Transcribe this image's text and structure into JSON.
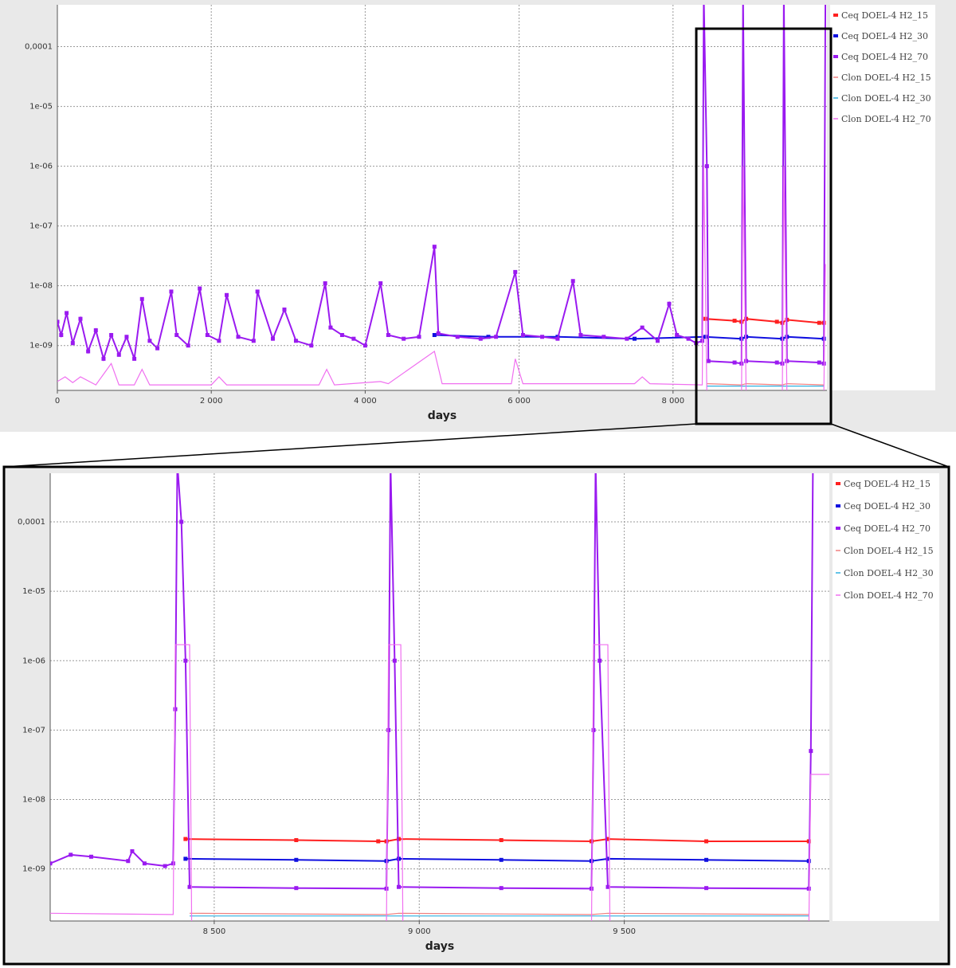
{
  "chart_data": [
    {
      "name": "overview",
      "type": "line",
      "xlabel": "days",
      "ylabel": "",
      "title": "",
      "yscale": "log",
      "xlim": [
        0,
        10000
      ],
      "ylim_log10": [
        -9.75,
        -3.3
      ],
      "x_ticks": [
        0,
        2000,
        4000,
        6000,
        8000
      ],
      "x_tick_labels": [
        "0",
        "2 000",
        "4 000",
        "6 000",
        "8 000"
      ],
      "y_ticks_log10": [
        -9,
        -8,
        -7,
        -6,
        -5,
        -4
      ],
      "y_tick_labels": [
        "1e-09",
        "1e-08",
        "1e-07",
        "1e-06",
        "1e-05",
        "0,0001"
      ],
      "grid": true,
      "legend_position": "right",
      "series": [
        {
          "name": "Ceq DOEL-4 H2_15",
          "color": "#ff2020",
          "style": "markers",
          "points": [
            [
              8420,
              2.8e-09
            ],
            [
              8800,
              2.6e-09
            ],
            [
              8890,
              2.5e-09
            ],
            [
              8950,
              2.8e-09
            ],
            [
              9350,
              2.5e-09
            ],
            [
              9420,
              2.4e-09
            ],
            [
              9480,
              2.7e-09
            ],
            [
              9900,
              2.4e-09
            ],
            [
              9960,
              2.4e-09
            ]
          ]
        },
        {
          "name": "Ceq DOEL-4 H2_30",
          "color": "#1010e0",
          "style": "markers",
          "points": [
            [
              4900,
              1.5e-09
            ],
            [
              5600,
              1.4e-09
            ],
            [
              6500,
              1.4e-09
            ],
            [
              7500,
              1.3e-09
            ],
            [
              8420,
              1.4e-09
            ],
            [
              8890,
              1.3e-09
            ],
            [
              8950,
              1.4e-09
            ],
            [
              9420,
              1.3e-09
            ],
            [
              9480,
              1.4e-09
            ],
            [
              9960,
              1.3e-09
            ]
          ]
        },
        {
          "name": "Ceq DOEL-4 H2_70",
          "color": "#9a1af0",
          "style": "markers",
          "points": [
            [
              0,
              2.5e-09
            ],
            [
              50,
              1.5e-09
            ],
            [
              120,
              3.5e-09
            ],
            [
              200,
              1.1e-09
            ],
            [
              300,
              2.8e-09
            ],
            [
              400,
              8e-10
            ],
            [
              500,
              1.8e-09
            ],
            [
              600,
              6e-10
            ],
            [
              700,
              1.5e-09
            ],
            [
              800,
              7e-10
            ],
            [
              900,
              1.4e-09
            ],
            [
              1000,
              6e-10
            ],
            [
              1100,
              6e-09
            ],
            [
              1200,
              1.2e-09
            ],
            [
              1300,
              9e-10
            ],
            [
              1480,
              8e-09
            ],
            [
              1550,
              1.5e-09
            ],
            [
              1700,
              1e-09
            ],
            [
              1850,
              9e-09
            ],
            [
              1950,
              1.5e-09
            ],
            [
              2100,
              1.2e-09
            ],
            [
              2200,
              7e-09
            ],
            [
              2350,
              1.4e-09
            ],
            [
              2550,
              1.2e-09
            ],
            [
              2600,
              8e-09
            ],
            [
              2800,
              1.3e-09
            ],
            [
              2950,
              4e-09
            ],
            [
              3100,
              1.2e-09
            ],
            [
              3300,
              1e-09
            ],
            [
              3480,
              1.1e-08
            ],
            [
              3550,
              2e-09
            ],
            [
              3700,
              1.5e-09
            ],
            [
              3850,
              1.3e-09
            ],
            [
              4000,
              1e-09
            ],
            [
              4200,
              1.1e-08
            ],
            [
              4300,
              1.5e-09
            ],
            [
              4500,
              1.3e-09
            ],
            [
              4700,
              1.4e-09
            ],
            [
              4900,
              4.5e-08
            ],
            [
              4950,
              1.6e-09
            ],
            [
              5200,
              1.4e-09
            ],
            [
              5500,
              1.3e-09
            ],
            [
              5700,
              1.4e-09
            ],
            [
              5950,
              1.7e-08
            ],
            [
              6050,
              1.5e-09
            ],
            [
              6300,
              1.4e-09
            ],
            [
              6500,
              1.3e-09
            ],
            [
              6700,
              1.2e-08
            ],
            [
              6800,
              1.5e-09
            ],
            [
              7100,
              1.4e-09
            ],
            [
              7400,
              1.3e-09
            ],
            [
              7600,
              2e-09
            ],
            [
              7800,
              1.2e-09
            ],
            [
              7950,
              5e-09
            ],
            [
              8050,
              1.5e-09
            ],
            [
              8200,
              1.3e-09
            ],
            [
              8300,
              1.1e-09
            ],
            [
              8380,
              1.2e-09
            ],
            [
              8400,
              0.0007
            ],
            [
              8440,
              1e-06
            ],
            [
              8460,
              5.5e-10
            ],
            [
              8800,
              5.2e-10
            ],
            [
              8890,
              5e-10
            ],
            [
              8910,
              0.0007
            ],
            [
              8950,
              5.5e-10
            ],
            [
              9350,
              5.2e-10
            ],
            [
              9420,
              5e-10
            ],
            [
              9440,
              0.0007
            ],
            [
              9480,
              5.5e-10
            ],
            [
              9900,
              5.2e-10
            ],
            [
              9960,
              5e-10
            ],
            [
              9980,
              0.0007
            ]
          ]
        },
        {
          "name": "Clon DOEL-4 H2_15",
          "color": "#f08080",
          "style": "line",
          "points": [
            [
              8440,
              2.3e-10
            ],
            [
              8890,
              2.2e-10
            ],
            [
              8950,
              2.3e-10
            ],
            [
              9420,
              2.2e-10
            ],
            [
              9480,
              2.3e-10
            ],
            [
              9960,
              2.2e-10
            ]
          ]
        },
        {
          "name": "Clon DOEL-4 H2_30",
          "color": "#30b0e0",
          "style": "line",
          "points": [
            [
              8440,
              2.1e-10
            ],
            [
              8890,
              2.1e-10
            ],
            [
              8950,
              2.1e-10
            ],
            [
              9420,
              2.1e-10
            ],
            [
              9480,
              2.1e-10
            ],
            [
              9960,
              2.1e-10
            ]
          ]
        },
        {
          "name": "Clon DOEL-4 H2_70",
          "color": "#f070f0",
          "style": "line",
          "points": [
            [
              0,
              2.5e-10
            ],
            [
              100,
              3e-10
            ],
            [
              200,
              2.4e-10
            ],
            [
              300,
              3e-10
            ],
            [
              500,
              2.2e-10
            ],
            [
              700,
              5e-10
            ],
            [
              800,
              2.2e-10
            ],
            [
              1000,
              2.2e-10
            ],
            [
              1100,
              4e-10
            ],
            [
              1200,
              2.2e-10
            ],
            [
              2000,
              2.2e-10
            ],
            [
              2100,
              3e-10
            ],
            [
              2200,
              2.2e-10
            ],
            [
              3000,
              2.2e-10
            ],
            [
              3400,
              2.2e-10
            ],
            [
              3500,
              4e-10
            ],
            [
              3600,
              2.2e-10
            ],
            [
              4200,
              2.5e-10
            ],
            [
              4300,
              2.3e-10
            ],
            [
              4900,
              8e-10
            ],
            [
              5000,
              2.3e-10
            ],
            [
              5900,
              2.3e-10
            ],
            [
              5950,
              6e-10
            ],
            [
              6050,
              2.3e-10
            ],
            [
              7000,
              2.3e-10
            ],
            [
              7500,
              2.3e-10
            ],
            [
              7600,
              3e-10
            ],
            [
              7700,
              2.3e-10
            ],
            [
              8380,
              2.2e-10
            ],
            [
              8400,
              1e-06
            ],
            [
              8440,
              1.5e-10
            ],
            [
              8890,
              1.5e-10
            ],
            [
              8910,
              1e-06
            ],
            [
              8950,
              1.5e-10
            ],
            [
              9420,
              1.5e-10
            ],
            [
              9440,
              1e-06
            ],
            [
              9480,
              1.5e-10
            ],
            [
              9960,
              1.5e-10
            ],
            [
              9980,
              2.3e-08
            ]
          ]
        }
      ]
    },
    {
      "name": "zoom",
      "type": "line",
      "xlabel": "days",
      "ylabel": "",
      "title": "",
      "yscale": "log",
      "xlim": [
        8100,
        10000
      ],
      "ylim_log10": [
        -9.75,
        -3.3
      ],
      "x_ticks": [
        8500,
        9000,
        9500
      ],
      "x_tick_labels": [
        "8 500",
        "9 000",
        "9 500"
      ],
      "y_ticks_log10": [
        -9,
        -8,
        -7,
        -6,
        -5,
        -4
      ],
      "y_tick_labels": [
        "1e-09",
        "1e-08",
        "1e-07",
        "1e-06",
        "1e-05",
        "0,0001"
      ],
      "grid": true,
      "legend_position": "right",
      "series": [
        {
          "name": "Ceq DOEL-4 H2_15",
          "color": "#ff2020",
          "style": "markers",
          "points": [
            [
              8430,
              2.7e-09
            ],
            [
              8700,
              2.6e-09
            ],
            [
              8900,
              2.5e-09
            ],
            [
              8920,
              2.5e-09
            ],
            [
              8950,
              2.7e-09
            ],
            [
              9200,
              2.6e-09
            ],
            [
              9420,
              2.5e-09
            ],
            [
              9460,
              2.7e-09
            ],
            [
              9700,
              2.5e-09
            ],
            [
              9950,
              2.5e-09
            ]
          ]
        },
        {
          "name": "Ceq DOEL-4 H2_30",
          "color": "#1010e0",
          "style": "markers",
          "points": [
            [
              8430,
              1.4e-09
            ],
            [
              8700,
              1.35e-09
            ],
            [
              8920,
              1.3e-09
            ],
            [
              8950,
              1.4e-09
            ],
            [
              9200,
              1.35e-09
            ],
            [
              9420,
              1.3e-09
            ],
            [
              9460,
              1.4e-09
            ],
            [
              9700,
              1.35e-09
            ],
            [
              9950,
              1.3e-09
            ]
          ]
        },
        {
          "name": "Ceq DOEL-4 H2_70",
          "color": "#9a1af0",
          "style": "markers",
          "points": [
            [
              8100,
              1.2e-09
            ],
            [
              8150,
              1.6e-09
            ],
            [
              8200,
              1.5e-09
            ],
            [
              8290,
              1.3e-09
            ],
            [
              8300,
              1.8e-09
            ],
            [
              8330,
              1.2e-09
            ],
            [
              8380,
              1.1e-09
            ],
            [
              8400,
              1.2e-09
            ],
            [
              8405,
              2e-07
            ],
            [
              8410,
              0.0007
            ],
            [
              8420,
              0.0001
            ],
            [
              8430,
              1e-06
            ],
            [
              8440,
              5.5e-10
            ],
            [
              8700,
              5.3e-10
            ],
            [
              8920,
              5.2e-10
            ],
            [
              8925,
              1e-07
            ],
            [
              8930,
              0.0007
            ],
            [
              8940,
              1e-06
            ],
            [
              8950,
              5.5e-10
            ],
            [
              9200,
              5.3e-10
            ],
            [
              9420,
              5.2e-10
            ],
            [
              9425,
              1e-07
            ],
            [
              9430,
              0.0007
            ],
            [
              9440,
              1e-06
            ],
            [
              9460,
              5.5e-10
            ],
            [
              9700,
              5.3e-10
            ],
            [
              9950,
              5.2e-10
            ],
            [
              9955,
              5e-08
            ],
            [
              9960,
              0.0006
            ],
            [
              9980,
              0.00055
            ],
            [
              9990,
              0.00055
            ]
          ]
        },
        {
          "name": "Clon DOEL-4 H2_15",
          "color": "#f08080",
          "style": "line",
          "points": [
            [
              8440,
              2.3e-10
            ],
            [
              8920,
              2.2e-10
            ],
            [
              8950,
              2.3e-10
            ],
            [
              9420,
              2.2e-10
            ],
            [
              9460,
              2.3e-10
            ],
            [
              9950,
              2.2e-10
            ]
          ]
        },
        {
          "name": "Clon DOEL-4 H2_30",
          "color": "#30b0e0",
          "style": "line",
          "points": [
            [
              8440,
              2.1e-10
            ],
            [
              8920,
              2.1e-10
            ],
            [
              8950,
              2.1e-10
            ],
            [
              9420,
              2.1e-10
            ],
            [
              9460,
              2.1e-10
            ],
            [
              9950,
              2.1e-10
            ]
          ]
        },
        {
          "name": "Clon DOEL-4 H2_70",
          "color": "#f070f0",
          "style": "line",
          "points": [
            [
              8100,
              2.3e-10
            ],
            [
              8400,
              2.2e-10
            ],
            [
              8405,
              1.7e-06
            ],
            [
              8440,
              1.7e-06
            ],
            [
              8445,
              1.5e-10
            ],
            [
              8920,
              1.5e-10
            ],
            [
              8925,
              1.7e-06
            ],
            [
              8955,
              1.7e-06
            ],
            [
              8960,
              1.5e-10
            ],
            [
              9420,
              1.5e-10
            ],
            [
              9425,
              1.7e-06
            ],
            [
              9460,
              1.7e-06
            ],
            [
              9465,
              1.5e-10
            ],
            [
              9950,
              1.5e-10
            ],
            [
              9955,
              2.3e-08
            ],
            [
              10000,
              2.3e-08
            ]
          ]
        }
      ]
    }
  ]
}
